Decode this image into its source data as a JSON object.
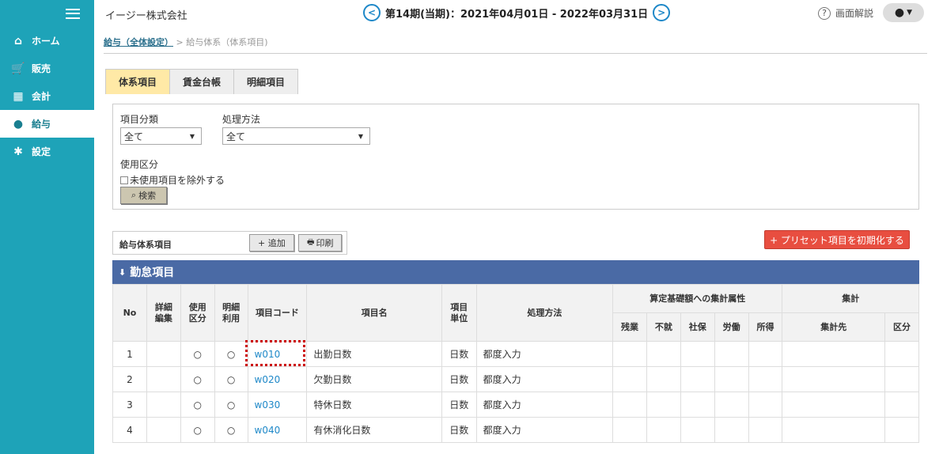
{
  "sidebar": {
    "items": [
      {
        "label": "ホーム",
        "icon": "home-icon"
      },
      {
        "label": "販売",
        "icon": "cart-icon"
      },
      {
        "label": "会計",
        "icon": "calculator-icon"
      },
      {
        "label": "給与",
        "icon": "money-bag-icon"
      },
      {
        "label": "設定",
        "icon": "gear-icon"
      }
    ]
  },
  "header": {
    "company": "イージー株式会社",
    "period": "第14期(当期)：2021年04月01日 - 2022年03月31日",
    "help": "画面解説",
    "help_icon": "?"
  },
  "breadcrumb": {
    "parent": "給与（全体設定）",
    "separator": ">",
    "current": "給与体系（体系項目)"
  },
  "tabs": [
    "体系項目",
    "賃金台帳",
    "明細項目"
  ],
  "filter": {
    "category_label": "項目分類",
    "category_value": "全て",
    "method_label": "処理方法",
    "method_value": "全て",
    "usage_label": "使用区分",
    "exclude_label": "未使用項目を除外する",
    "search_label": "検索",
    "search_icon": "⌕"
  },
  "toolbar": {
    "title": "給与体系項目",
    "add_label": "+ 追加",
    "print_label": "印刷",
    "print_icon": "🖶",
    "preset_label": "+ プリセット項目を初期化する"
  },
  "section": {
    "title": "勤怠項目",
    "arrow": "⬇"
  },
  "table": {
    "headers": {
      "no": "No",
      "detail": [
        "詳細",
        "編集"
      ],
      "use": [
        "使用",
        "区分"
      ],
      "detail_use": [
        "明細",
        "利用"
      ],
      "code": "項目コード",
      "name": "項目名",
      "unit": [
        "項目",
        "単位"
      ],
      "method": "処理方法",
      "calc_group": "算定基礎額への集計属性",
      "calc_cols": [
        "残業",
        "不就",
        "社保",
        "労働",
        "所得"
      ],
      "sum_group": "集計",
      "sum_cols": [
        "集計先",
        "区分"
      ]
    },
    "rows": [
      {
        "no": "1",
        "use": "○",
        "detail_use": "○",
        "code": "w010",
        "name": "出勤日数",
        "unit": "日数",
        "method": "都度入力"
      },
      {
        "no": "2",
        "use": "○",
        "detail_use": "○",
        "code": "w020",
        "name": "欠勤日数",
        "unit": "日数",
        "method": "都度入力"
      },
      {
        "no": "3",
        "use": "○",
        "detail_use": "○",
        "code": "w030",
        "name": "特休日数",
        "unit": "日数",
        "method": "都度入力"
      },
      {
        "no": "4",
        "use": "○",
        "detail_use": "○",
        "code": "w040",
        "name": "有休消化日数",
        "unit": "日数",
        "method": "都度入力"
      }
    ]
  },
  "colors": {
    "sidebar": "#1ea3b8",
    "section": "#4a6aa5",
    "preset_button": "#e84e40",
    "active_tab": "#ffe9a6",
    "highlight": "#cc0000"
  }
}
